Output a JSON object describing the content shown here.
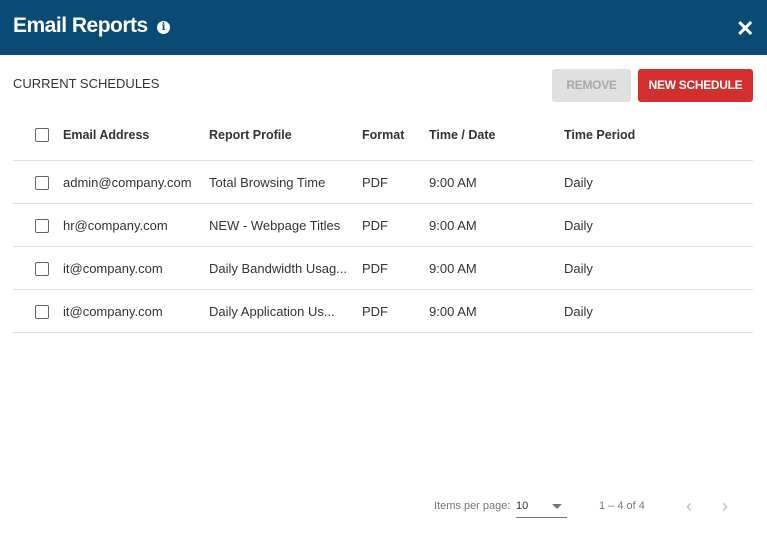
{
  "header": {
    "title": "Email Reports",
    "info_icon": "i",
    "close_icon": "✕"
  },
  "section_title": "CURRENT SCHEDULES",
  "buttons": {
    "remove": "REMOVE",
    "new_schedule": "NEW SCHEDULE"
  },
  "colors": {
    "header": "#094b75",
    "primary": "#d32f2f"
  },
  "table": {
    "columns": [
      "Email Address",
      "Report Profile",
      "Format",
      "Time / Date",
      "Time Period"
    ],
    "rows": [
      [
        "admin@company.com",
        "Total Browsing Time",
        "PDF",
        "9:00 AM",
        "Daily"
      ],
      [
        "hr@company.com",
        "NEW - Webpage Titles",
        "PDF",
        "9:00 AM",
        "Daily"
      ],
      [
        "it@company.com",
        "Daily Bandwidth Usag...",
        "PDF",
        "9:00 AM",
        "Daily"
      ],
      [
        "it@company.com",
        "Daily Application Us...",
        "PDF",
        "9:00 AM",
        "Daily"
      ]
    ]
  },
  "pagination": {
    "items_per_page_label": "Items per page:",
    "items_per_page": "10",
    "range": "1 – 4 of 4",
    "prev": "‹",
    "next": "›"
  }
}
